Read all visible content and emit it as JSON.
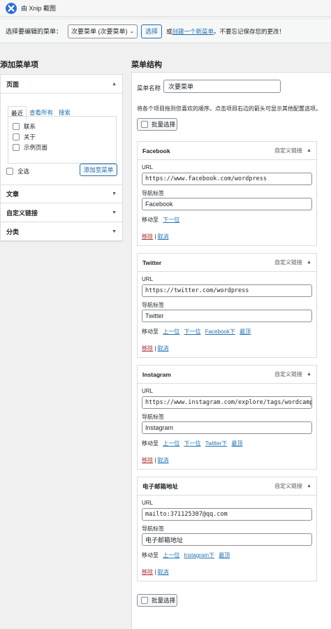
{
  "titlebar": {
    "title": "由 Xnip 截图"
  },
  "select_bar": {
    "label": "选择要编辑的菜单：",
    "menu_value": "次要菜单 (次要菜单)",
    "select_button": "选择",
    "or_text": "或",
    "create_link": "创建一个新菜单",
    "reminder": "。不要忘记保存您的更改！"
  },
  "left": {
    "heading": "添加菜单项",
    "pages": {
      "title": "页面",
      "tabs": [
        "最近",
        "查看所有",
        "搜索"
      ],
      "items": [
        "联系",
        "关于",
        "示例页面"
      ],
      "select_all": "全选",
      "add_button": "添加至菜单"
    },
    "sections": [
      "文章",
      "自定义链接",
      "分类"
    ]
  },
  "right": {
    "heading": "菜单结构",
    "name_label": "菜单名称",
    "name_value": "次要菜单",
    "description": "将各个项目拖到您喜欢的顺序。点击项目右边的箭头可显示其他配置选项。",
    "bulk_select": "批量选择",
    "item_type": "自定义链接",
    "url_label": "URL",
    "nav_label": "导航标签",
    "move_to": "移动至",
    "remove": "移除",
    "cancel": "取消",
    "separator": "|",
    "items": [
      {
        "title": "Facebook",
        "url": "https://www.facebook.com/wordpress",
        "label": "Facebook",
        "moves": [
          "下一位"
        ]
      },
      {
        "title": "Twitter",
        "url": "https://twitter.com/wordpress",
        "label": "Twitter",
        "moves": [
          "上一位",
          "下一位",
          "Facebook下",
          "最顶"
        ]
      },
      {
        "title": "Instagram",
        "url": "https://www.instagram.com/explore/tags/wordcamp/",
        "label": "Instagram",
        "moves": [
          "上一位",
          "下一位",
          "Twitter下",
          "最顶"
        ]
      },
      {
        "title": "电子邮箱地址",
        "url": "mailto:371125307@qq.com",
        "label": "电子邮箱地址",
        "moves": [
          "上一位",
          "Instagram下",
          "最顶"
        ]
      }
    ]
  },
  "colors": {
    "link": "#2271b1",
    "remove": "#b32d2e",
    "background": "#f0f0f1"
  }
}
